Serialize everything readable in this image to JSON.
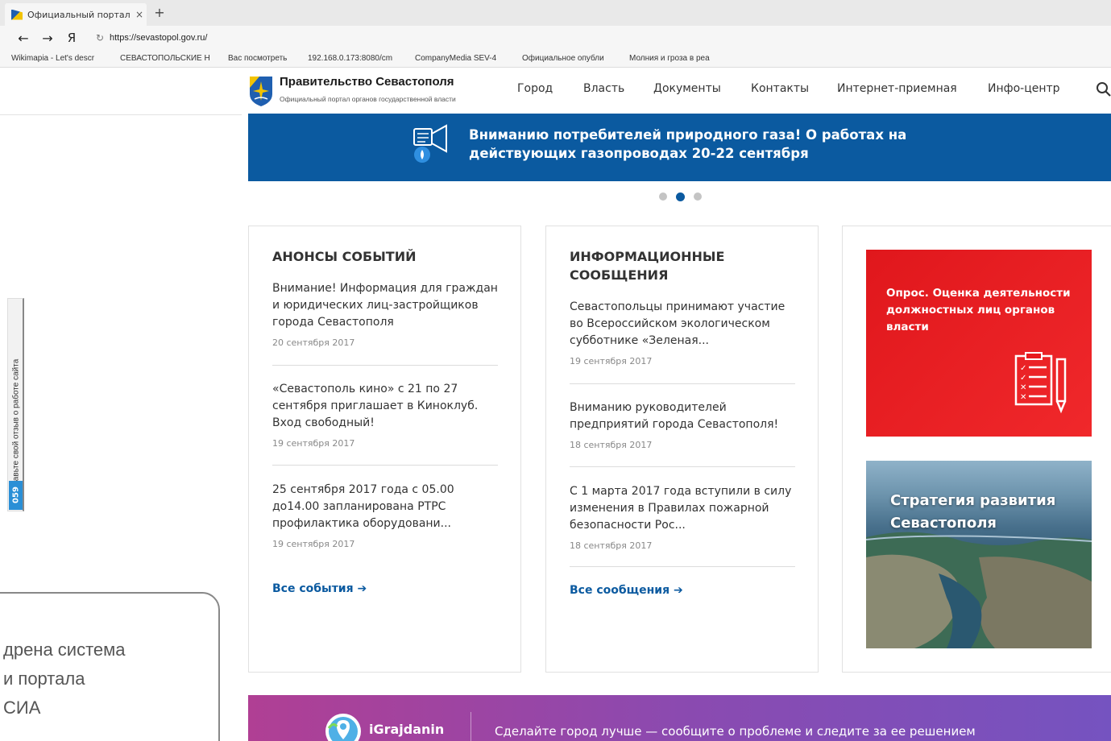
{
  "browser": {
    "tab_title": "Официальный портал ор",
    "tab_close": "×",
    "new_tab": "+",
    "back": "←",
    "forward": "→",
    "yandex": "Я",
    "reload": "↻",
    "url": "https://sevastopol.gov.ru/",
    "bookmarks": [
      "Wikimapia - Let's descr",
      "СЕВАСТОПОЛЬСКИЕ Н",
      "Вас посмотреть",
      "192.168.0.173:8080/cm",
      "CompanyMedia SEV-4",
      "Официальное опубли",
      "Молния и гроза в реа"
    ]
  },
  "header": {
    "title": "Правительство Севастополя",
    "subtitle": "Официальный портал органов государственной власти",
    "nav": [
      "Город",
      "Власть",
      "Документы",
      "Контакты",
      "Интернет-приемная",
      "Инфо-центр"
    ]
  },
  "banner": {
    "text": "Вниманию потребителей природного газа! О работах на действующих газопроводах 20-22 сентября",
    "slides_total": 3,
    "active_slide": 2
  },
  "events": {
    "title": "Анонсы событий",
    "items": [
      {
        "text": "Внимание! Информация для граждан и юридических лиц-застройщиков города Севастополя",
        "date": "20 сентября 2017"
      },
      {
        "text": "«Севастополь кино» с 21 по 27 сентября приглашает в Киноклуб. Вход свободный!",
        "date": "19 сентября 2017"
      },
      {
        "text": "25 сентября 2017 года с 05.00 до14.00 запланирована РТРС профилактика оборудовани...",
        "date": "19 сентября 2017"
      }
    ],
    "more": "Все события",
    "arrow": "➔"
  },
  "messages": {
    "title": "Информационные сообщения",
    "items": [
      {
        "text": "Севастопольцы принимают участие во Всероссийском экологическом субботнике «Зеленая...",
        "date": "19 сентября 2017"
      },
      {
        "text": "Вниманию руководителей предприятий города Севастополя!",
        "date": "18 сентября 2017"
      },
      {
        "text": "С 1 марта 2017 года вступили в силу изменения в Правилах пожарной безопасности Рос...",
        "date": "18 сентября 2017"
      }
    ],
    "more": "Все сообщения",
    "arrow": "➔"
  },
  "promo": {
    "survey": "Опрос. Оценка деятельности должностных лиц органов власти",
    "strategy": "Стратегия развития Севастополя"
  },
  "feedback": {
    "text": "Оставьте свой отзыв о работе сайта",
    "badge": "059"
  },
  "overlay": {
    "line1": "дрена система",
    "line2": "и портала",
    "line3": "СИА"
  },
  "igrajdanin": {
    "name": "iGrajdanin",
    "text": "Сделайте город лучше — сообщите о проблеме и следите за ее решением"
  },
  "colors": {
    "brand_blue": "#0b5aa0",
    "survey_red": "#e8191d",
    "igrajdanin_start": "#b03f94",
    "igrajdanin_end": "#7553c0"
  }
}
